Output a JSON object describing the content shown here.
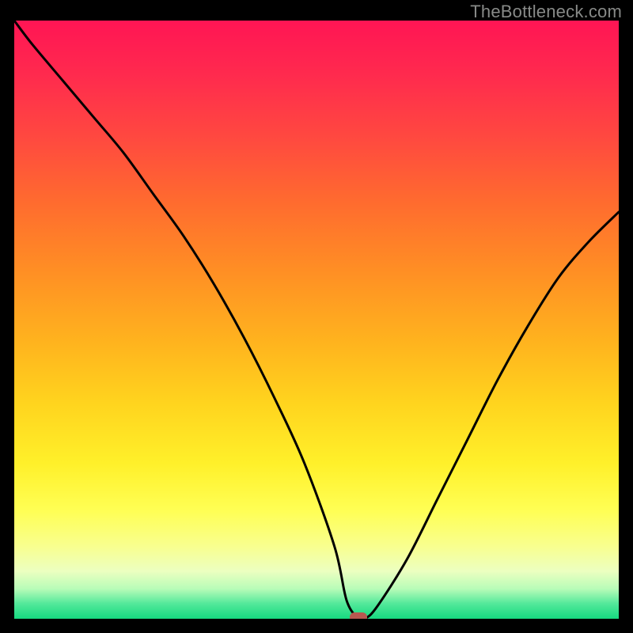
{
  "watermark": "TheBottleneck.com",
  "chart_data": {
    "type": "line",
    "title": "",
    "xlabel": "",
    "ylabel": "",
    "xlim": [
      0,
      100
    ],
    "ylim": [
      0,
      100
    ],
    "grid": false,
    "legend": false,
    "series": [
      {
        "name": "bottleneck-curve",
        "x": [
          0,
          3,
          8,
          13,
          18,
          23,
          28,
          33,
          38,
          43,
          48,
          53,
          55,
          57,
          58,
          60,
          65,
          70,
          75,
          80,
          85,
          90,
          95,
          100
        ],
        "values": [
          100,
          96,
          90,
          84,
          78,
          71,
          64,
          56,
          47,
          37,
          26,
          12,
          3,
          0,
          0,
          2,
          10,
          20,
          30,
          40,
          49,
          57,
          63,
          68
        ]
      }
    ],
    "marker": {
      "x": 57,
      "y": 0,
      "name": "optimal-point"
    },
    "background_gradient": {
      "stops": [
        {
          "pct": 0,
          "color": "#ff1554"
        },
        {
          "pct": 50,
          "color": "#ffb41e"
        },
        {
          "pct": 82,
          "color": "#ffff55"
        },
        {
          "pct": 100,
          "color": "#16d980"
        }
      ]
    }
  }
}
